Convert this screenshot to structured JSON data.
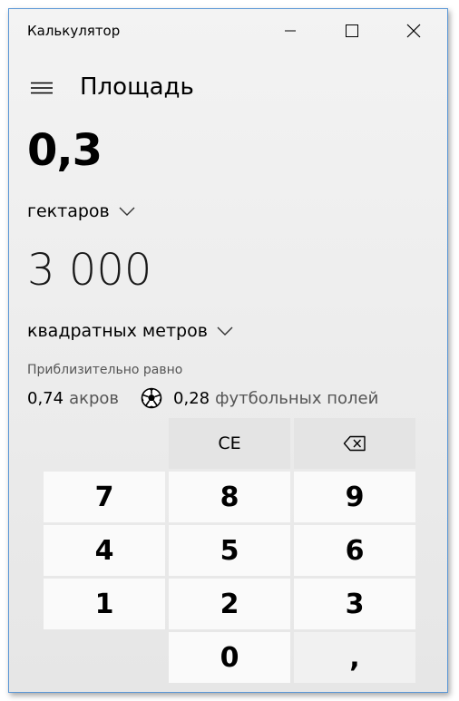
{
  "window": {
    "title": "Калькулятор"
  },
  "header": {
    "mode_title": "Площадь"
  },
  "converter": {
    "from_value": "0,3",
    "from_unit": "гектаров",
    "to_value": "3 000",
    "to_unit": "квадратных метров"
  },
  "approx": {
    "label": "Приблизительно равно",
    "item1_value": "0,74",
    "item1_unit": "акров",
    "item2_value": "0,28",
    "item2_unit": "футбольных полей"
  },
  "keypad": {
    "ce": "CE",
    "k7": "7",
    "k8": "8",
    "k9": "9",
    "k4": "4",
    "k5": "5",
    "k6": "6",
    "k1": "1",
    "k2": "2",
    "k3": "3",
    "k0": "0",
    "decimal": ","
  },
  "icons": {
    "minimize": "minimize-icon",
    "maximize": "maximize-icon",
    "close": "close-icon",
    "menu": "hamburger-icon",
    "dropdown": "chevron-down-icon",
    "football": "soccer-ball-icon",
    "backspace": "backspace-icon"
  },
  "colors": {
    "window_border": "#5a97d6",
    "number_key_bg": "#fafafa",
    "function_key_bg": "#e4e4e4"
  }
}
